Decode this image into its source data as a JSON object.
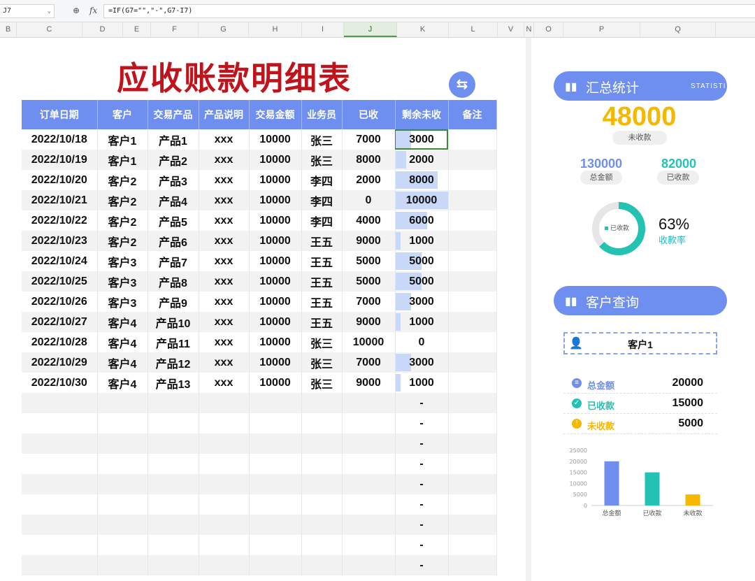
{
  "formula_bar": {
    "name_box": "J7",
    "formula": "=IF(G7=\"\",\"-\",G7-I7)"
  },
  "columns": [
    "B",
    "C",
    "D",
    "E",
    "F",
    "G",
    "H",
    "I",
    "J",
    "K",
    "L",
    "V",
    "N",
    "O",
    "P",
    "Q"
  ],
  "selected_column": "J",
  "sheet": {
    "title": "应收账款明细表",
    "swap_icon": "swap-arrows-icon",
    "headers": [
      "订单日期",
      "客户",
      "交易产品",
      "产品说明",
      "交易金额",
      "业务员",
      "已收",
      "剩余未收",
      "备注"
    ],
    "rows": [
      [
        "2022/10/18",
        "客户1",
        "产品1",
        "xxx",
        "10000",
        "张三",
        "7000",
        "3000",
        ""
      ],
      [
        "2022/10/19",
        "客户1",
        "产品2",
        "xxx",
        "10000",
        "张三",
        "8000",
        "2000",
        ""
      ],
      [
        "2022/10/20",
        "客户2",
        "产品3",
        "xxx",
        "10000",
        "李四",
        "2000",
        "8000",
        ""
      ],
      [
        "2022/10/21",
        "客户2",
        "产品4",
        "xxx",
        "10000",
        "李四",
        "0",
        "10000",
        ""
      ],
      [
        "2022/10/22",
        "客户2",
        "产品5",
        "xxx",
        "10000",
        "李四",
        "4000",
        "6000",
        ""
      ],
      [
        "2022/10/23",
        "客户2",
        "产品6",
        "xxx",
        "10000",
        "王五",
        "9000",
        "1000",
        ""
      ],
      [
        "2022/10/24",
        "客户3",
        "产品7",
        "xxx",
        "10000",
        "王五",
        "5000",
        "5000",
        ""
      ],
      [
        "2022/10/25",
        "客户3",
        "产品8",
        "xxx",
        "10000",
        "王五",
        "5000",
        "5000",
        ""
      ],
      [
        "2022/10/26",
        "客户3",
        "产品9",
        "xxx",
        "10000",
        "王五",
        "7000",
        "3000",
        ""
      ],
      [
        "2022/10/27",
        "客户4",
        "产品10",
        "xxx",
        "10000",
        "王五",
        "9000",
        "1000",
        ""
      ],
      [
        "2022/10/28",
        "客户4",
        "产品11",
        "xxx",
        "10000",
        "张三",
        "10000",
        "0",
        ""
      ],
      [
        "2022/10/29",
        "客户4",
        "产品12",
        "xxx",
        "10000",
        "张三",
        "7000",
        "3000",
        ""
      ],
      [
        "2022/10/30",
        "客户4",
        "产品13",
        "xxx",
        "10000",
        "张三",
        "9000",
        "1000",
        ""
      ]
    ],
    "empty_rows": 9,
    "empty_remaining": "-",
    "data_bar_max": 10000
  },
  "summary": {
    "title": "汇总统计",
    "title_en": "STATISTICS",
    "unpaid_value": "48000",
    "unpaid_label": "未收款",
    "total_value": "130000",
    "total_label": "总金额",
    "received_value": "82000",
    "received_label": "已收款",
    "ring_legend": "已收款",
    "rate_value": "63%",
    "rate_label": "收款率",
    "rate": 0.63
  },
  "query": {
    "title": "客户查询",
    "customer": "客户1",
    "items": [
      {
        "label": "总金额",
        "value": "20000",
        "color": "#6f8ff0",
        "icon": "database-icon"
      },
      {
        "label": "已收款",
        "value": "15000",
        "color": "#22c3b3",
        "icon": "check-circle-icon"
      },
      {
        "label": "未收款",
        "value": "5000",
        "color": "#f5b800",
        "icon": "warning-icon"
      }
    ]
  },
  "chart_data": {
    "type": "bar",
    "categories": [
      "总金额",
      "已收款",
      "未收款"
    ],
    "values": [
      20000,
      15000,
      5000
    ],
    "colors": [
      "#6f8ff0",
      "#22c3b3",
      "#f5b800"
    ],
    "ylim": [
      0,
      25000
    ],
    "yticks": [
      "0",
      "5000",
      "10000",
      "15000",
      "20000",
      "25000"
    ],
    "grid": false
  },
  "colors": {
    "accent": "#6f8ff0",
    "title_red": "#c0141c",
    "unpaid": "#f5b800",
    "received": "#22c3b3"
  }
}
